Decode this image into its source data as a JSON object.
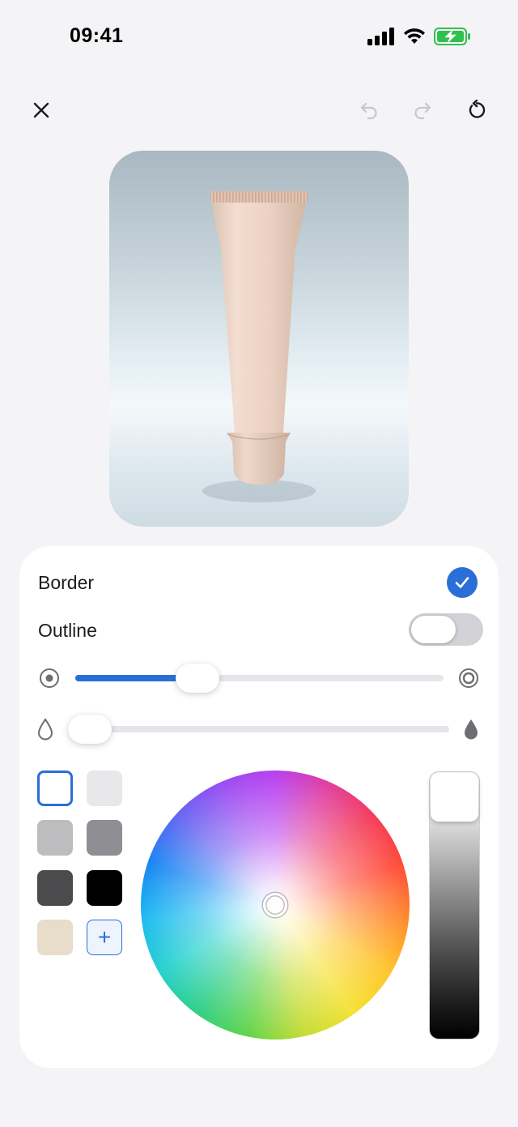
{
  "status_bar": {
    "time": "09:41",
    "battery_color": "#30c04f"
  },
  "toolbar": {
    "close_icon": "close-icon",
    "undo_icon": "undo-icon",
    "redo_icon": "redo-icon",
    "reset_icon": "reset-icon"
  },
  "panel": {
    "border_label": "Border",
    "border_checked": true,
    "outline_label": "Outline",
    "outline_on": false,
    "thickness_value": 0.35,
    "opacity_value": 0.0,
    "swatches": [
      {
        "color": "#ffffff",
        "selected": true
      },
      {
        "color": "#e8e8ea"
      },
      {
        "color": "#bdbdbf"
      },
      {
        "color": "#8e8e93"
      },
      {
        "color": "#4b4b4d"
      },
      {
        "color": "#000000"
      },
      {
        "color": "#e8dccb"
      }
    ],
    "add_swatch_label": "+",
    "accent_color": "#2a6fd6",
    "brightness_value": 1.0
  }
}
